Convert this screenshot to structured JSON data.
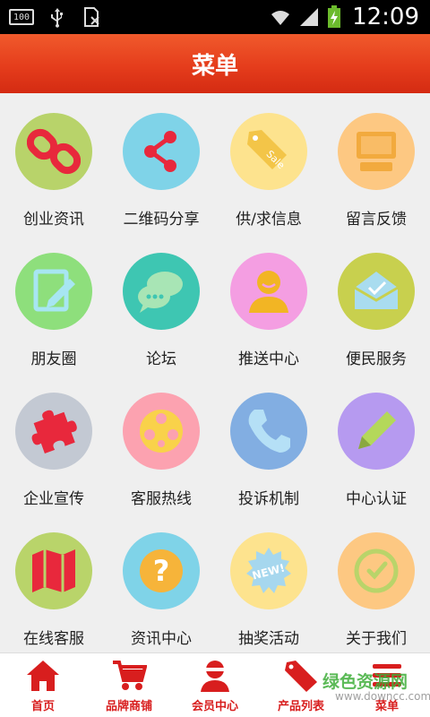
{
  "status_bar": {
    "battery_text": "100",
    "time": "12:09"
  },
  "header": {
    "title": "菜单"
  },
  "menu": {
    "items": [
      {
        "label": "创业资讯",
        "icon": "link-icon",
        "bg": "#b8d36a",
        "fg": "#e8283c"
      },
      {
        "label": "二维码分享",
        "icon": "share-icon",
        "bg": "#7fd3e8",
        "fg": "#e8283c"
      },
      {
        "label": "供/求信息",
        "icon": "sale-tag-icon",
        "bg": "#fde38e",
        "fg": "#f3c548"
      },
      {
        "label": "留言反馈",
        "icon": "monitor-icon",
        "bg": "#fdc882",
        "fg": "#f2aa3e"
      },
      {
        "label": "朋友圈",
        "icon": "edit-note-icon",
        "bg": "#8edf7c",
        "fg": "#a7e6f2"
      },
      {
        "label": "论坛",
        "icon": "chat-bubbles-icon",
        "bg": "#3ec6b2",
        "fg": "#a8e5b5"
      },
      {
        "label": "推送中心",
        "icon": "user-icon",
        "bg": "#f49ee2",
        "fg": "#f2b524"
      },
      {
        "label": "便民服务",
        "icon": "mail-icon",
        "bg": "#c8d04e",
        "fg": "#a9dcef"
      },
      {
        "label": "企业宣传",
        "icon": "puzzle-icon",
        "bg": "#c3c9d3",
        "fg": "#e8283c"
      },
      {
        "label": "客服热线",
        "icon": "film-reel-icon",
        "bg": "#fca2b0",
        "fg": "#f9d24a"
      },
      {
        "label": "投诉机制",
        "icon": "phone-icon",
        "bg": "#82aee2",
        "fg": "#b5e0f6"
      },
      {
        "label": "中心认证",
        "icon": "pencil-icon",
        "bg": "#b69af0",
        "fg": "#b4d85a"
      },
      {
        "label": "在线客服",
        "icon": "map-icon",
        "bg": "#b9d46a",
        "fg": "#e8283c"
      },
      {
        "label": "资讯中心",
        "icon": "help-icon",
        "bg": "#7fd3e8",
        "fg": "#f6b43a"
      },
      {
        "label": "抽奖活动",
        "icon": "new-badge-icon",
        "bg": "#fde38e",
        "fg": "#a6d7ee"
      },
      {
        "label": "关于我们",
        "icon": "clock-icon",
        "bg": "#fdc882",
        "fg": "#b9d46a"
      }
    ]
  },
  "bottom_nav": {
    "items": [
      {
        "label": "首页",
        "icon": "home-icon"
      },
      {
        "label": "品牌商铺",
        "icon": "cart-icon"
      },
      {
        "label": "会员中心",
        "icon": "member-icon"
      },
      {
        "label": "产品列表",
        "icon": "sale-tag-icon"
      },
      {
        "label": "菜单",
        "icon": "menu-icon"
      }
    ],
    "accent": "#d81e1e"
  },
  "watermark": {
    "text": "绿色资源网",
    "sub": "www.downcc.com"
  }
}
